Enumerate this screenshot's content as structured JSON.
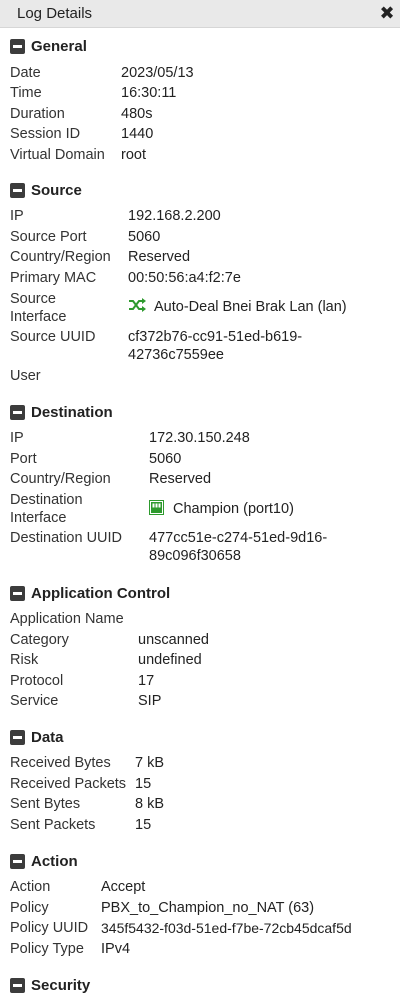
{
  "window": {
    "title": "Log Details"
  },
  "icons": {
    "close": "close-icon",
    "collapse": "minus-square-icon",
    "interface": "shuffle-icon",
    "port": "port-icon"
  },
  "colors": {
    "header_bg": "#e9e9e9",
    "icon_green": "#2e9a2e"
  },
  "general": {
    "title": "General",
    "rows": [
      {
        "label": "Date",
        "value": "2023/05/13"
      },
      {
        "label": "Time",
        "value": "16:30:11"
      },
      {
        "label": "Duration",
        "value": "480s"
      },
      {
        "label": "Session ID",
        "value": "1440"
      },
      {
        "label": "Virtual Domain",
        "value": "root"
      }
    ]
  },
  "source": {
    "title": "Source",
    "ip": {
      "label": "IP",
      "value": "192.168.2.200"
    },
    "port": {
      "label": "Source Port",
      "value": "5060"
    },
    "country": {
      "label": "Country/Region",
      "value": "Reserved"
    },
    "mac": {
      "label": "Primary MAC",
      "value": "00:50:56:a4:f2:7e"
    },
    "interface": {
      "label_line1": "Source",
      "label_line2": "Interface",
      "value": "Auto-Deal Bnei Brak Lan (lan)"
    },
    "uuid": {
      "label": "Source UUID",
      "value_line1": "cf372b76-cc91-51ed-b619-",
      "value_line2": "42736c7559ee"
    },
    "user": {
      "label": "User",
      "value": ""
    }
  },
  "destination": {
    "title": "Destination",
    "ip": {
      "label": "IP",
      "value": "172.30.150.248"
    },
    "port": {
      "label": "Port",
      "value": "5060"
    },
    "country": {
      "label": "Country/Region",
      "value": "Reserved"
    },
    "interface": {
      "label_line1": "Destination",
      "label_line2": "Interface",
      "value": "Champion (port10)"
    },
    "uuid": {
      "label": "Destination UUID",
      "value_line1": "477cc51e-c274-51ed-9d16-",
      "value_line2": "89c096f30658"
    }
  },
  "app_control": {
    "title": "Application Control",
    "rows": [
      {
        "label": "Application Name",
        "value": ""
      },
      {
        "label": "Category",
        "value": "unscanned"
      },
      {
        "label": "Risk",
        "value": "undefined"
      },
      {
        "label": "Protocol",
        "value": "17"
      },
      {
        "label": "Service",
        "value": "SIP"
      }
    ]
  },
  "data_section": {
    "title": "Data",
    "rows": [
      {
        "label": "Received Bytes",
        "value": "7 kB"
      },
      {
        "label": "Received Packets",
        "value": "15"
      },
      {
        "label": "Sent Bytes",
        "value": "8 kB"
      },
      {
        "label": "Sent Packets",
        "value": "15"
      }
    ]
  },
  "action": {
    "title": "Action",
    "rows": [
      {
        "label": "Action",
        "value": "Accept"
      },
      {
        "label": "Policy",
        "value": "PBX_to_Champion_no_NAT (63)"
      },
      {
        "label": "Policy UUID",
        "value": "345f5432-f03d-51ed-f7be-72cb45dcaf5d"
      },
      {
        "label": "Policy Type",
        "value": "IPv4"
      }
    ]
  },
  "security": {
    "title": "Security"
  }
}
